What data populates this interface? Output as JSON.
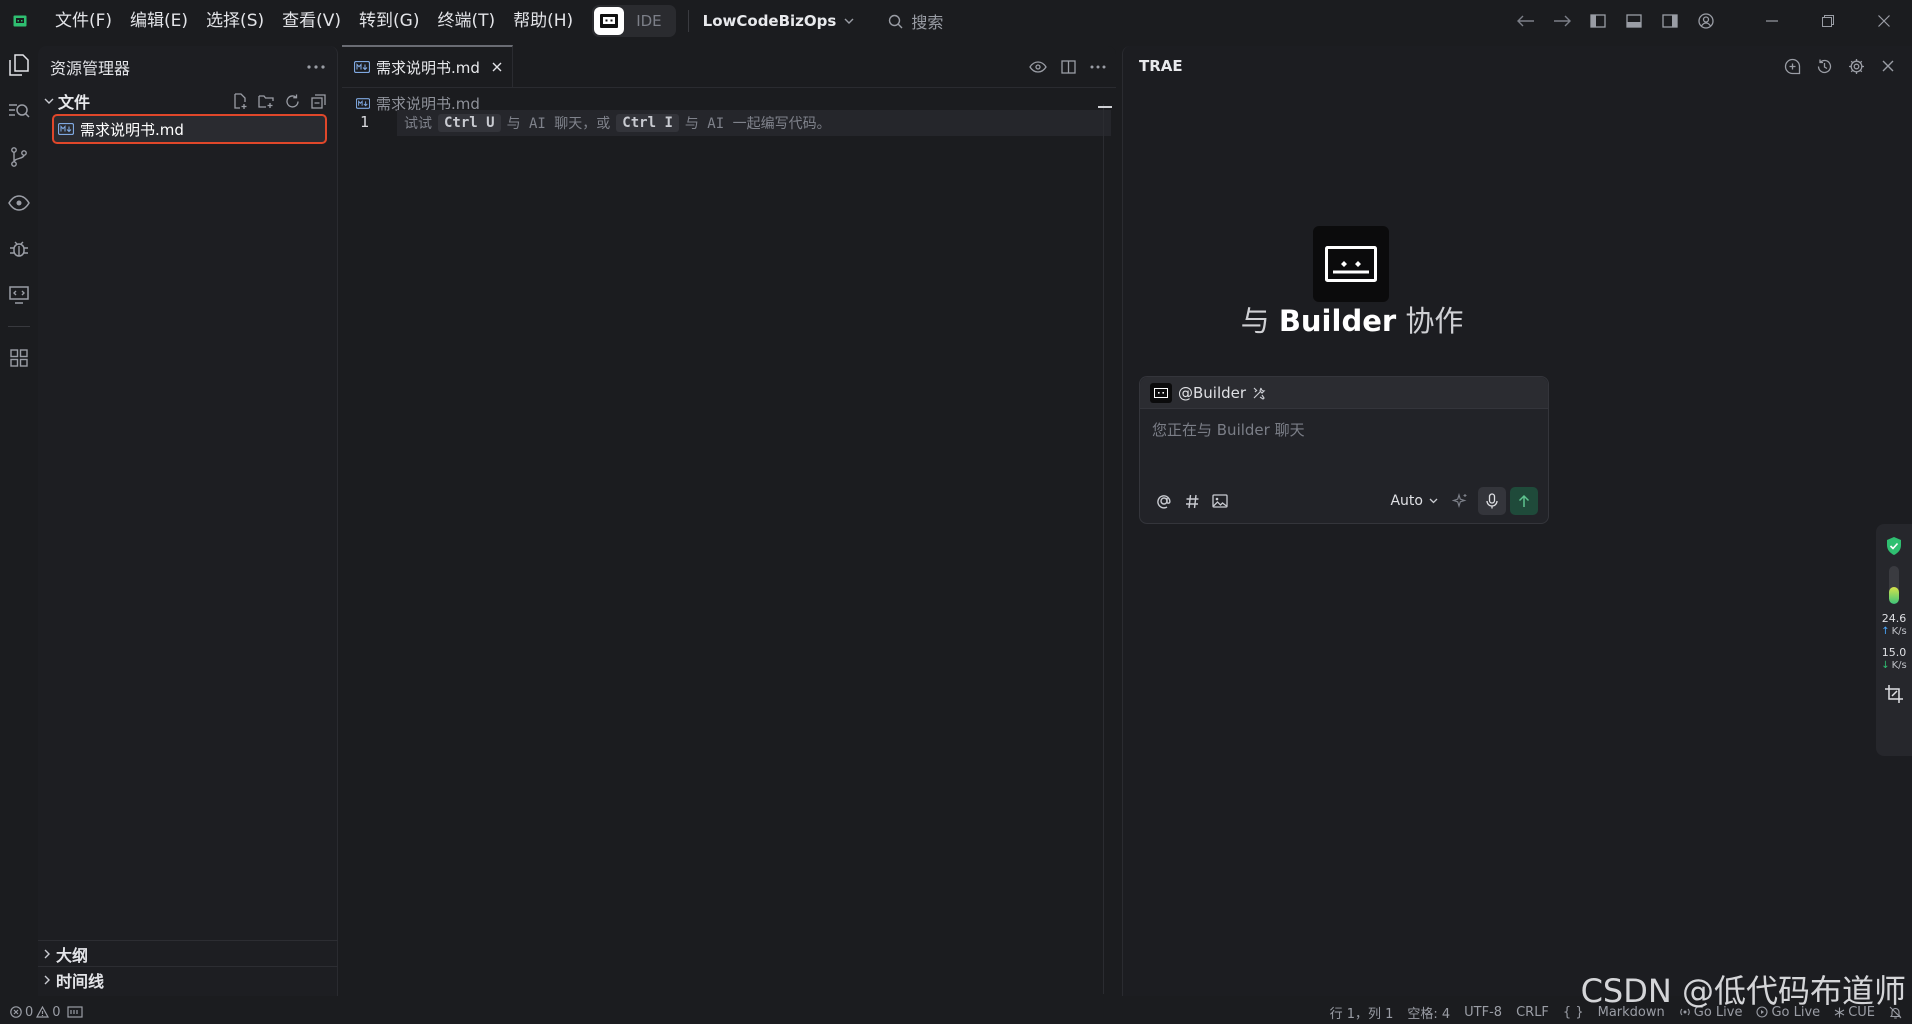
{
  "menu": {
    "items": [
      "文件(F)",
      "编辑(E)",
      "选择(S)",
      "查看(V)",
      "转到(G)",
      "终端(T)",
      "帮助(H)"
    ]
  },
  "mode": {
    "ide_label": "IDE"
  },
  "project": {
    "name": "LowCodeBizOps"
  },
  "search": {
    "label": "搜索"
  },
  "explorer": {
    "title": "资源管理器",
    "folder": "文件",
    "files": [
      "需求说明书.md"
    ],
    "outline_label": "大纲",
    "timeline_label": "时间线"
  },
  "editor": {
    "tab_label": "需求说明书.md",
    "breadcrumb": "需求说明书.md",
    "line_number": "1",
    "hint_part1": "试试",
    "hint_key1": "Ctrl U",
    "hint_part2": "与 AI 聊天，或",
    "hint_key2": "Ctrl I",
    "hint_part3": "与 AI 一起编写代码。"
  },
  "ai_panel": {
    "title": "TRAE",
    "welcome_prefix": "与",
    "welcome_agent": "Builder",
    "welcome_suffix": "协作",
    "agent_mention": "@Builder",
    "input_placeholder": "您正在与 Builder 聊天",
    "model": "Auto"
  },
  "net_widget": {
    "up_value": "24.6",
    "up_unit": "K/s",
    "down_value": "15.0",
    "down_unit": "K/s",
    "meter_level": 0.45
  },
  "status": {
    "errors": "0",
    "warnings": "0",
    "cursor": "行 1，列 1",
    "spaces": "空格: 4",
    "encoding": "UTF-8",
    "eol": "CRLF",
    "braces": "{ }",
    "language": "Markdown",
    "golive1": "Go Live",
    "golive2": "Go Live",
    "cue": "CUE"
  },
  "watermark": "CSDN @低代码布道师",
  "colors": {
    "accent_red": "#e0472a",
    "send_green": "#1f4a3a",
    "shield_green": "#2fbf71"
  }
}
